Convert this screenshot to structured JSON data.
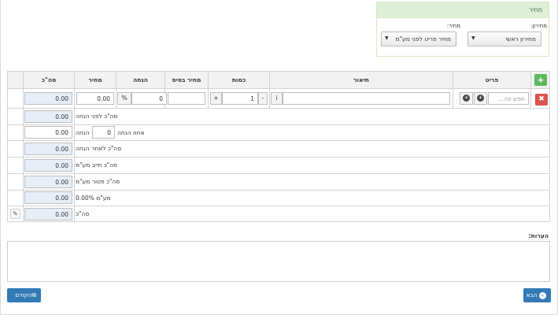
{
  "price_panel": {
    "title": "מחיר",
    "pricelist_label": "מחירון:",
    "pricelist_value": "מחירון ראשי",
    "price_label": "מחיר:",
    "price_value": "מחיר פריט לפני מע\"מ"
  },
  "table": {
    "headers": {
      "item": "פריט",
      "description": "תיאור",
      "quantity": "כמות",
      "base_price": "מחיר בסיס",
      "discount": "הנחה",
      "price": "מחיר",
      "total": "סה\"כ"
    },
    "row": {
      "search_placeholder": "חפש פה...",
      "info_button": "i",
      "plus_button": "+",
      "minus_button": "-",
      "quantity": "1",
      "base_price": "",
      "discount_percent": "0",
      "percent_symbol": "%",
      "price": "0.00",
      "total": "0.00",
      "add_button": "+",
      "delete_button": "✖"
    },
    "summary": {
      "subtotal_label": "סה\"כ לפני הנחה",
      "subtotal": "0.00",
      "discount_percent_label": "אחוז הנחה",
      "discount_percent": "0",
      "discount_label": "הנחה",
      "discount_amount": "0.00",
      "after_discount_label": "סה\"כ לאחר הנחה",
      "after_discount": "0.00",
      "vat_liable_label": "סה\"כ חייב מע\"מ",
      "vat_liable": "0.00",
      "vat_exempt_label": "סה\"כ פטור מע\"מ",
      "vat_exempt": "0.00",
      "vat_label": "מע\"מ 0.00%",
      "vat": "0.00",
      "grand_total_label": "סה\"כ",
      "grand_total": "0.00"
    }
  },
  "notes": {
    "label": "הערות:",
    "value": ""
  },
  "nav": {
    "next_label": "הבא",
    "prev_label": "הקודם"
  }
}
